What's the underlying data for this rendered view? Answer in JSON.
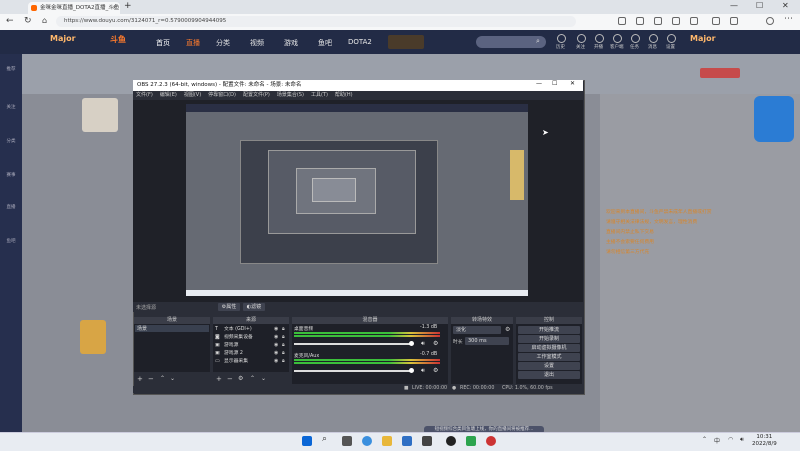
{
  "browser": {
    "tab_title": "金咪金咪直播_DOTA2直播_斗鱼",
    "url": "https://www.douyu.com/3124071_r=0.5790009904944095"
  },
  "douyu": {
    "logo": "斗鱼",
    "nav": [
      "首页",
      "直播",
      "分类",
      "视频",
      "游戏",
      "鱼吧",
      "DOTA2"
    ],
    "header_right": [
      "历史",
      "关注",
      "开播",
      "客户端",
      "任务",
      "消息",
      "设置"
    ],
    "sidebar": [
      "推荐",
      "关注",
      "分类",
      "赛事",
      "直播",
      "鱼吧"
    ],
    "chat": [
      "欢迎来到本直播间，斗鱼严禁未成年人直播或打赏",
      "请遵守相关法律法规，文明发言，理性消费",
      "直播间内禁止私下交易",
      "主播不会索要任何费用",
      "请勿相信第三方代充"
    ]
  },
  "obs": {
    "title": "OBS 27.2.3 (64-bit, windows) - 配置文件: 未命名 - 场景: 未命名",
    "menu": [
      "文件(F)",
      "编辑(E)",
      "视图(V)",
      "停靠窗口(D)",
      "配置文件(P)",
      "场景集合(S)",
      "工具(T)",
      "帮助(H)"
    ],
    "no_source": "未选择源",
    "props_btn": "属性",
    "filter_btn": "滤镜",
    "panels": {
      "scenes": "场景",
      "sources": "来源",
      "mixer": "混音器",
      "transitions": "转场特效",
      "controls": "控制"
    },
    "scene_items": [
      "场景"
    ],
    "source_items": [
      "文本 (GDI+)",
      "视频采集设备",
      "游戏源",
      "游戏源 2",
      "显示器采集"
    ],
    "mixer": [
      {
        "name": "桌面音频",
        "db": "-1.3 dB"
      },
      {
        "name": "麦克风/Aux",
        "db": "-0.7 dB"
      }
    ],
    "transition": "淡化",
    "duration_label": "时长",
    "duration": "300 ms",
    "controls": [
      "开始推流",
      "开始录制",
      "启动虚拟摄像机",
      "工作室模式",
      "设置",
      "退出"
    ],
    "status": {
      "live": "LIVE: 00:00:00",
      "rec": "REC: 00:00:00",
      "cpu": "CPU: 1.0%, 60.00 fps"
    }
  },
  "taskbar": {
    "time": "10:31",
    "date": "2022/8/9",
    "notice": "短视频综合类目鱼塘上线，你的直播间将被推荐..."
  }
}
